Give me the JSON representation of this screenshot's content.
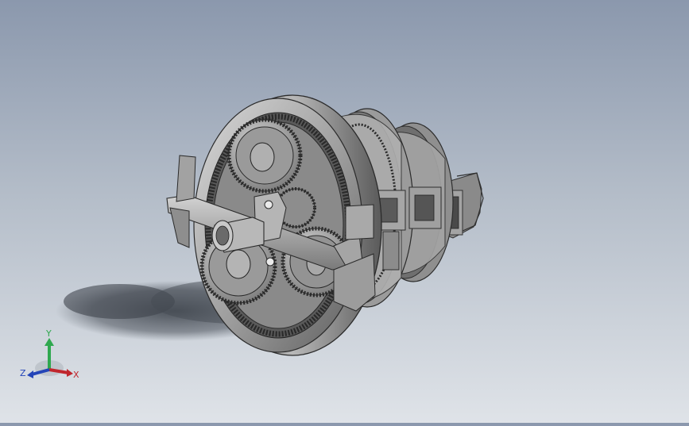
{
  "view_triad": {
    "x_label": "X",
    "y_label": "Y",
    "z_label": "Z",
    "x_color": "#c0262d",
    "y_color": "#2fa84f",
    "z_color": "#2445b8"
  },
  "model": {
    "icon": "planetary-gearbox-model"
  }
}
